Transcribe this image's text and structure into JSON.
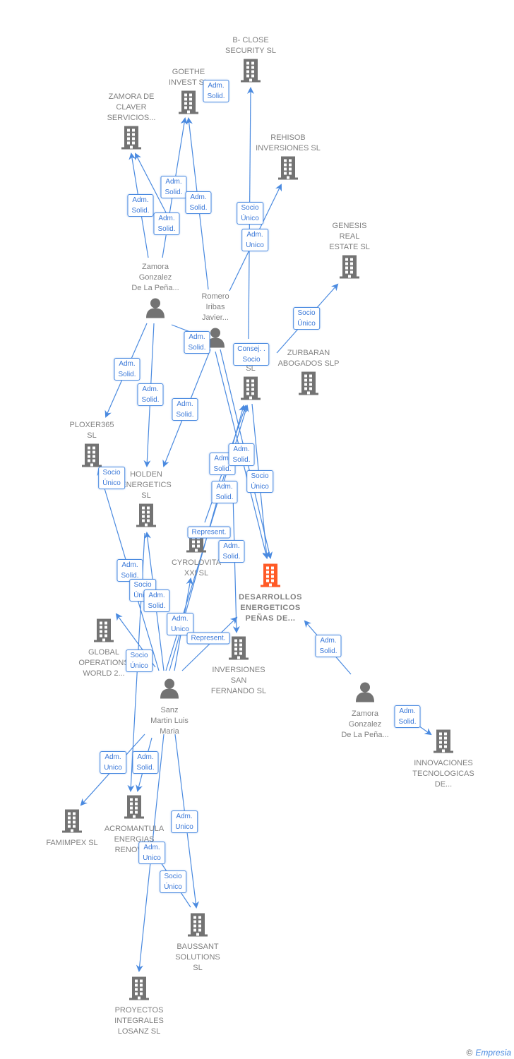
{
  "colors": {
    "edge": "#4a8ae0",
    "node": "#737373",
    "highlight": "#ff5a26",
    "label_text": "#3a78d8"
  },
  "nodes": [
    {
      "type": "company",
      "label": "B- CLOSE\nSECURITY  SL"
    },
    {
      "type": "company",
      "label": "GOETHE\nINVEST  SL"
    },
    {
      "type": "company",
      "label": "ZAMORA DE\nCLAVER\nSERVICIOS..."
    },
    {
      "type": "company",
      "label": "REHISOB\nINVERSIONES SL"
    },
    {
      "type": "company",
      "label": "GENESIS\nREAL\nESTATE  SL"
    },
    {
      "type": "person",
      "label": "Zamora\nGonzalez\nDe La Peña..."
    },
    {
      "type": "person",
      "label": "Romero\nIribas\nJavier..."
    },
    {
      "type": "company",
      "label": "T...\nEN...\nSL"
    },
    {
      "type": "company",
      "label": "ZURBARAN\nABOGADOS  SLP"
    },
    {
      "type": "company",
      "label": "PLOXER365\nSL"
    },
    {
      "type": "company",
      "label": "HOLDEN\nENERGETICS\nSL"
    },
    {
      "type": "company",
      "label": "CYROLOVITA\nXXI  SL"
    },
    {
      "type": "company",
      "label": "DESARROLLOS\nENERGETICOS\nPEÑAS DE...",
      "highlight": true
    },
    {
      "type": "company",
      "label": "GLOBAL\nOPERATIONS\nWORLD 2..."
    },
    {
      "type": "company",
      "label": "INVERSIONES\nSAN\nFERNANDO SL"
    },
    {
      "type": "person",
      "label": "Sanz\nMartin Luis\nMaria"
    },
    {
      "type": "person",
      "label": "Zamora\nGonzalez\nDe La Peña..."
    },
    {
      "type": "company",
      "label": "INNOVACIONES\nTECNOLOGICAS\nDE..."
    },
    {
      "type": "company",
      "label": "FAMIMPEX  SL"
    },
    {
      "type": "company",
      "label": "ACROMANTULA\nENERGIAS\nRENOVA..."
    },
    {
      "type": "company",
      "label": "BAUSSANT\nSOLUTIONS\nSL"
    },
    {
      "type": "company",
      "label": "PROYECTOS\nINTEGRALES\nLOSANZ SL"
    }
  ],
  "edge_labels": [
    "Adm.\nSolid.",
    "Adm.\nSolid.",
    "Adm.\nSolid.",
    "Adm.\nSolid.",
    "Adm.\nSolid.",
    "Socio\nÚnico",
    "Adm.\nUnico",
    "Socio\nÚnico",
    "Adm.\nSolid.",
    "Consej. .\nSocio",
    "Adm.\nSolid.",
    "Adm.\nSolid.",
    "Adm.\nSolid.",
    "Adm.\nSolid.",
    "Adm.\nSolid.",
    "Socio\nÚnico",
    "Socio\nÚnico",
    "Adm.\nSolid.",
    "Represent.",
    "Adm.\nSolid.",
    "Adm.\nSolid.",
    "Socio\nÚnico",
    "Adm.\nSolid.",
    "Adm.\nUnico",
    "Represent.",
    "Socio\nÚnico",
    "Adm.\nSolid.",
    "Adm.\nSolid.",
    "Adm.\nUnico",
    "Adm.\nSolid.",
    "Adm.\nUnico",
    "Adm.\nUnico",
    "Socio\nÚnico"
  ],
  "footer": {
    "copyright": "©",
    "brand": "Empresia"
  }
}
